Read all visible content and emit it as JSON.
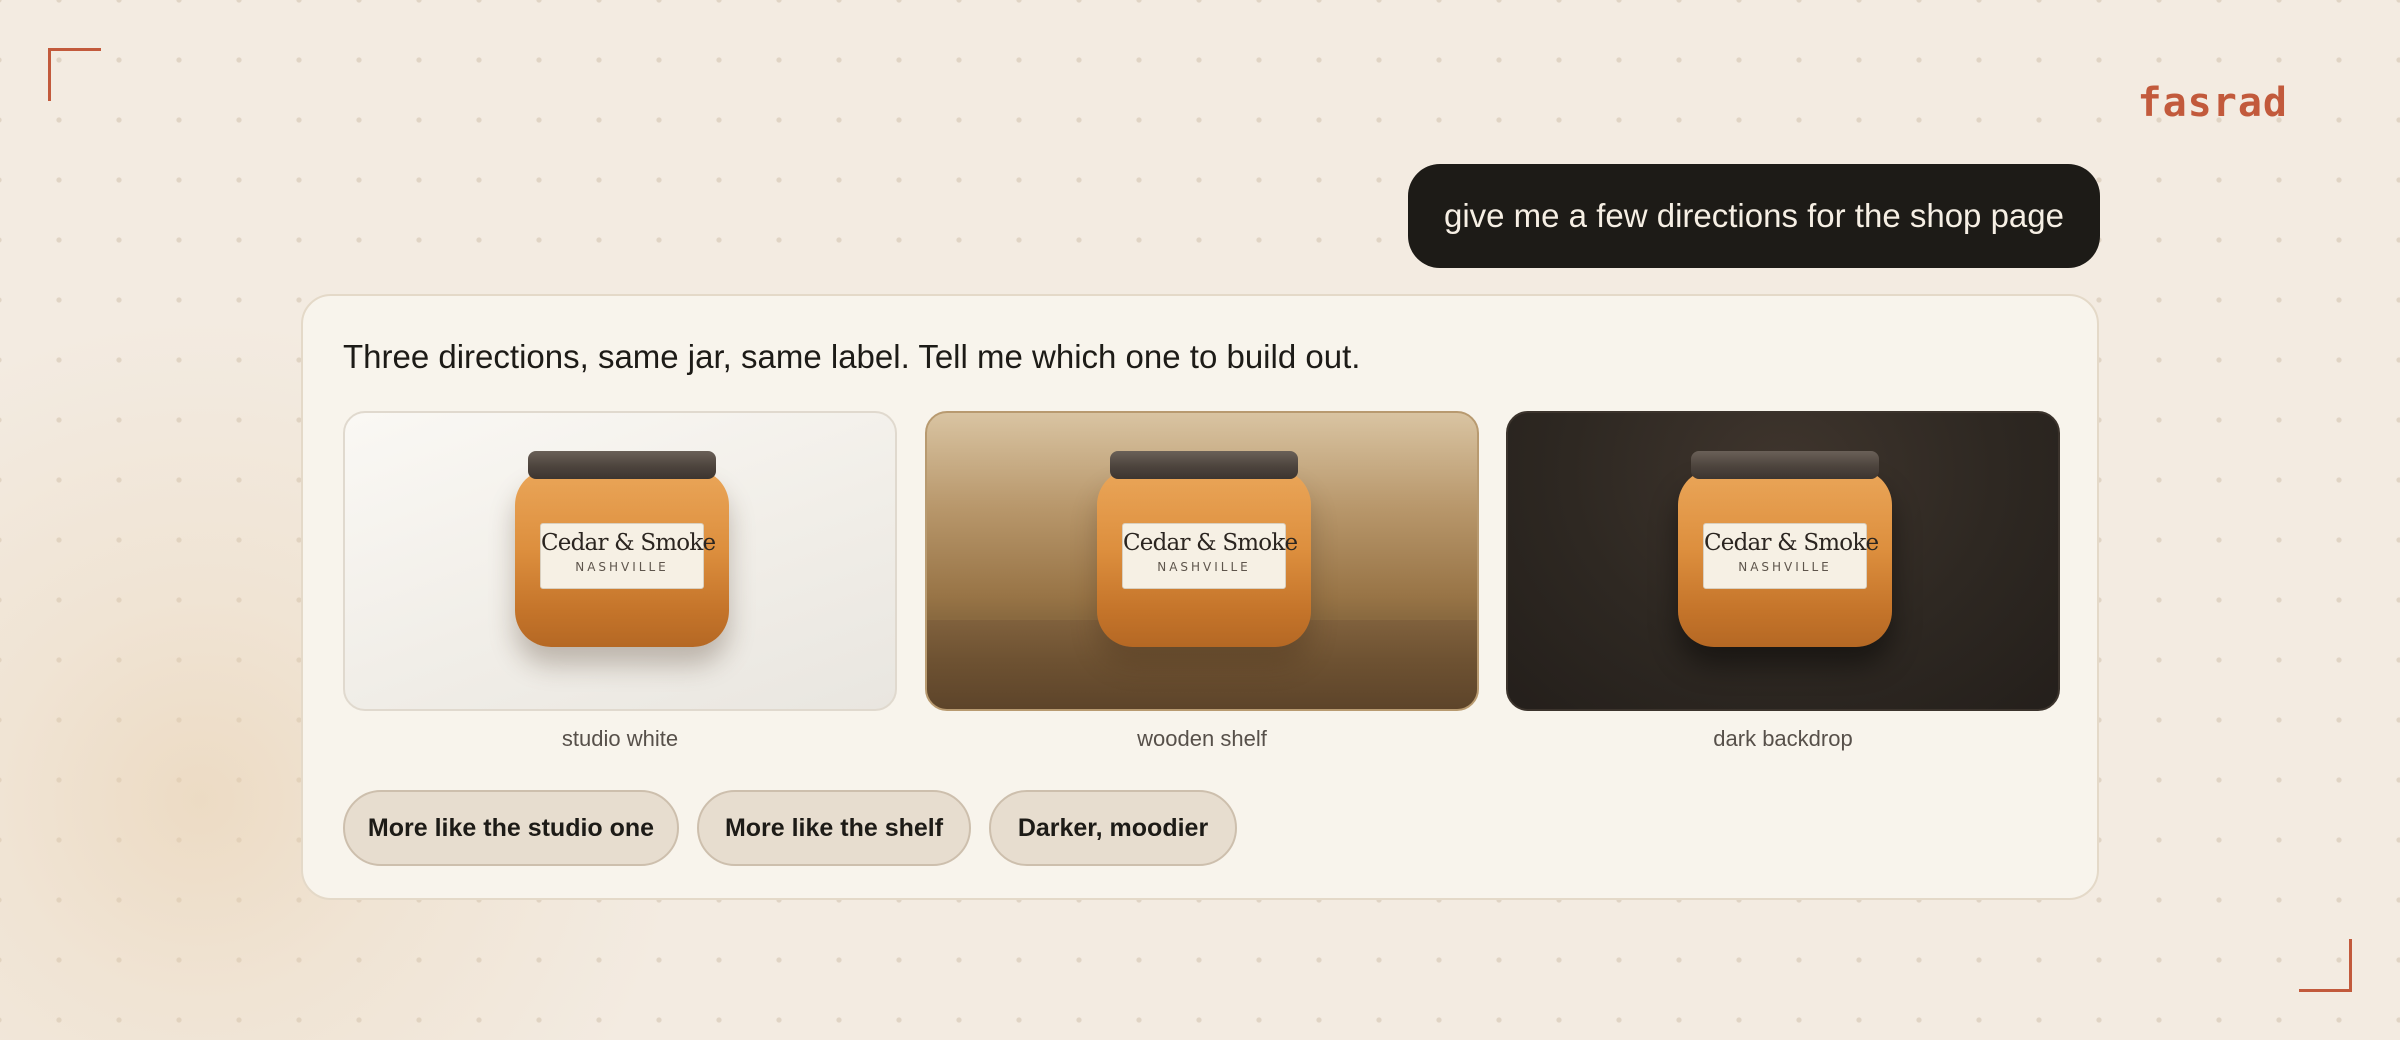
{
  "brand": {
    "name": "fasrad"
  },
  "user_message": {
    "text": "give me a few directions for the shop page"
  },
  "assistant": {
    "text": "Three directions, same jar, same label. Tell me which one to build out.",
    "options": [
      {
        "caption": "studio white",
        "jar_title": "Cedar & Smoke",
        "jar_subtitle": "NASHVILLE"
      },
      {
        "caption": "wooden shelf",
        "jar_title": "Cedar & Smoke",
        "jar_subtitle": "NASHVILLE"
      },
      {
        "caption": "dark backdrop",
        "jar_title": "Cedar & Smoke",
        "jar_subtitle": "NASHVILLE"
      }
    ],
    "suggestions": [
      {
        "label": "More like the studio one"
      },
      {
        "label": "More like the shelf"
      },
      {
        "label": "Darker, moodier"
      }
    ]
  },
  "colors": {
    "accent": "#c25a3c",
    "page_background": "#f3ebe1",
    "user_bubble": "#1d1b17",
    "jar_amber": "#dd8f3e"
  }
}
